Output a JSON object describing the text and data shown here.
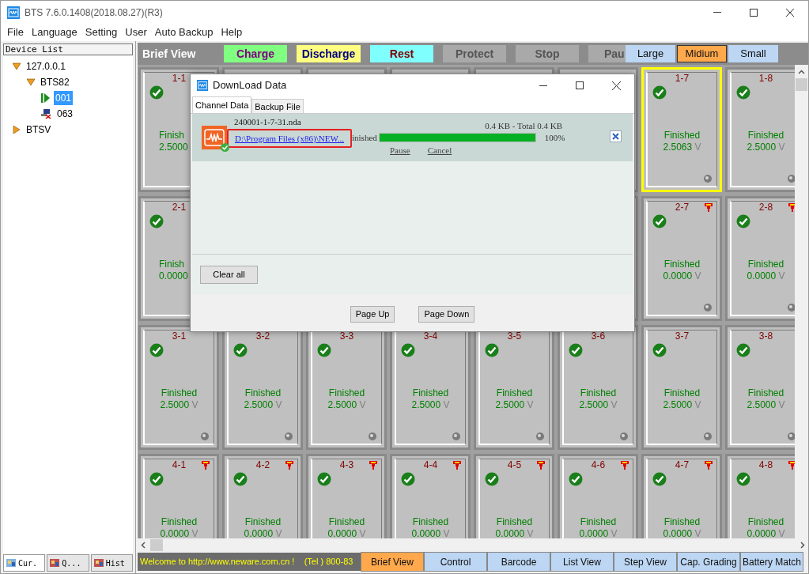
{
  "window": {
    "title": "BTS 7.6.0.1408(2018.08.27)(R3)"
  },
  "menu": [
    "File",
    "Language",
    "Setting",
    "User",
    "Auto Backup",
    "Help"
  ],
  "device_list": {
    "title": "Device List",
    "tree": [
      {
        "label": "127.0.0.1",
        "kind": "group",
        "expanded": true,
        "selected": false,
        "children": [
          {
            "label": "BTS82",
            "kind": "group",
            "expanded": true,
            "selected": false,
            "children": [
              {
                "label": "001",
                "kind": "running",
                "selected": true
              },
              {
                "label": "063",
                "kind": "offline",
                "selected": false
              }
            ]
          }
        ]
      },
      {
        "label": "BTSV",
        "kind": "group",
        "expanded": false,
        "selected": false
      }
    ]
  },
  "left_tabs": [
    {
      "label": "Cur.",
      "selected": true
    },
    {
      "label": "Q...",
      "selected": false
    },
    {
      "label": "Hist",
      "selected": false
    }
  ],
  "brief_bar": {
    "title": "Brief View",
    "states": [
      {
        "label": "Charge",
        "kind": "charge",
        "color": "#80ff80"
      },
      {
        "label": "Discharge",
        "kind": "discharge",
        "color": "#ffff80"
      },
      {
        "label": "Rest",
        "kind": "rest",
        "color": "#80ffff"
      },
      {
        "label": "Protect",
        "kind": "inactive",
        "color": "#a9a9a9"
      },
      {
        "label": "Stop",
        "kind": "inactive",
        "color": "#a9a9a9"
      },
      {
        "label": "Pau",
        "kind": "inactive",
        "color": "#a9a9a9"
      }
    ],
    "sizes": [
      {
        "label": "Large",
        "selected": false
      },
      {
        "label": "Midium",
        "selected": true
      },
      {
        "label": "Small",
        "selected": false
      }
    ]
  },
  "rows": [
    {
      "cards": [
        {
          "label": "1-1",
          "kind": "partial",
          "status": "Finish",
          "reading": "2.5000",
          "selected": false
        },
        {
          "label": "1-7",
          "kind": "full",
          "status": "Finished",
          "reading": "2.5063",
          "unit": "V",
          "selected": true,
          "flag": false
        },
        {
          "label": "1-8",
          "kind": "full",
          "status": "Finished",
          "reading": "2.5000",
          "unit": "V",
          "selected": false,
          "flag": false
        }
      ]
    },
    {
      "cards": [
        {
          "label": "2-1",
          "kind": "partial",
          "status": "Finish",
          "reading": "0.0000",
          "selected": false
        },
        {
          "label": "2-7",
          "kind": "full",
          "status": "Finished",
          "reading": "0.0000",
          "unit": "V",
          "selected": false,
          "flag": true
        },
        {
          "label": "2-8",
          "kind": "full",
          "status": "Finished",
          "reading": "0.0000",
          "unit": "V",
          "selected": false,
          "flag": true
        }
      ]
    },
    {
      "cards": [
        {
          "label": "3-1",
          "kind": "full",
          "status": "Finished",
          "reading": "2.5000",
          "unit": "V",
          "selected": false,
          "flag": false
        },
        {
          "label": "3-2",
          "kind": "full",
          "status": "Finished",
          "reading": "2.5000",
          "unit": "V",
          "selected": false,
          "flag": false
        },
        {
          "label": "3-3",
          "kind": "full",
          "status": "Finished",
          "reading": "2.5000",
          "unit": "V",
          "selected": false,
          "flag": false
        },
        {
          "label": "3-4",
          "kind": "full",
          "status": "Finished",
          "reading": "2.5000",
          "unit": "V",
          "selected": false,
          "flag": false
        },
        {
          "label": "3-5",
          "kind": "full",
          "status": "Finished",
          "reading": "2.5000",
          "unit": "V",
          "selected": false,
          "flag": false
        },
        {
          "label": "3-6",
          "kind": "full",
          "status": "Finished",
          "reading": "2.5000",
          "unit": "V",
          "selected": false,
          "flag": false
        },
        {
          "label": "3-7",
          "kind": "full",
          "status": "Finished",
          "reading": "2.5000",
          "unit": "V",
          "selected": false,
          "flag": false
        },
        {
          "label": "3-8",
          "kind": "full",
          "status": "Finished",
          "reading": "2.5000",
          "unit": "V",
          "selected": false,
          "flag": false
        }
      ]
    },
    {
      "cards": [
        {
          "label": "4-1",
          "kind": "full",
          "status": "Finished",
          "reading": "0.0000",
          "unit": "V",
          "selected": false,
          "flag": true
        },
        {
          "label": "4-2",
          "kind": "full",
          "status": "Finished",
          "reading": "0.0000",
          "unit": "V",
          "selected": false,
          "flag": true
        },
        {
          "label": "4-3",
          "kind": "full",
          "status": "Finished",
          "reading": "0.0000",
          "unit": "V",
          "selected": false,
          "flag": true
        },
        {
          "label": "4-4",
          "kind": "full",
          "status": "Finished",
          "reading": "0.0000",
          "unit": "V",
          "selected": false,
          "flag": true
        },
        {
          "label": "4-5",
          "kind": "full",
          "status": "Finished",
          "reading": "0.0000",
          "unit": "V",
          "selected": false,
          "flag": true
        },
        {
          "label": "4-6",
          "kind": "full",
          "status": "Finished",
          "reading": "0.0000",
          "unit": "V",
          "selected": false,
          "flag": true
        },
        {
          "label": "4-7",
          "kind": "full",
          "status": "Finished",
          "reading": "0.0000",
          "unit": "V",
          "selected": false,
          "flag": true
        },
        {
          "label": "4-8",
          "kind": "full",
          "status": "Finished",
          "reading": "0.0000",
          "unit": "V",
          "selected": false,
          "flag": true
        }
      ]
    }
  ],
  "dialog": {
    "title": "DownLoad Data",
    "tabs": [
      {
        "label": "Channel Data",
        "selected": true
      },
      {
        "label": "Backup File",
        "selected": false
      }
    ],
    "download": {
      "file": "240001-1-7-31.nda",
      "path": "D:\\Program Files (x86)\\NEW...",
      "highlighted": true,
      "size": "0.4 KB - Total 0.4 KB",
      "status": "inished",
      "level": 1,
      "percent": "100%",
      "actions": [
        "Pause",
        "Cancel"
      ]
    },
    "clear_button": "Clear all",
    "buttons": [
      "Page Up",
      "Page Down"
    ]
  },
  "status_bar": {
    "marquee": "Welcome to http://www.neware.com.cn !    (Tel ) 800-83",
    "tabs": [
      {
        "label": "Brief View",
        "selected": true
      },
      {
        "label": "Control",
        "selected": false
      },
      {
        "label": "Barcode",
        "selected": false
      },
      {
        "label": "List View",
        "selected": false
      },
      {
        "label": "Step View",
        "selected": false
      },
      {
        "label": "Cap. Grading",
        "selected": false
      },
      {
        "label": "Battery Match",
        "selected": false
      }
    ]
  }
}
